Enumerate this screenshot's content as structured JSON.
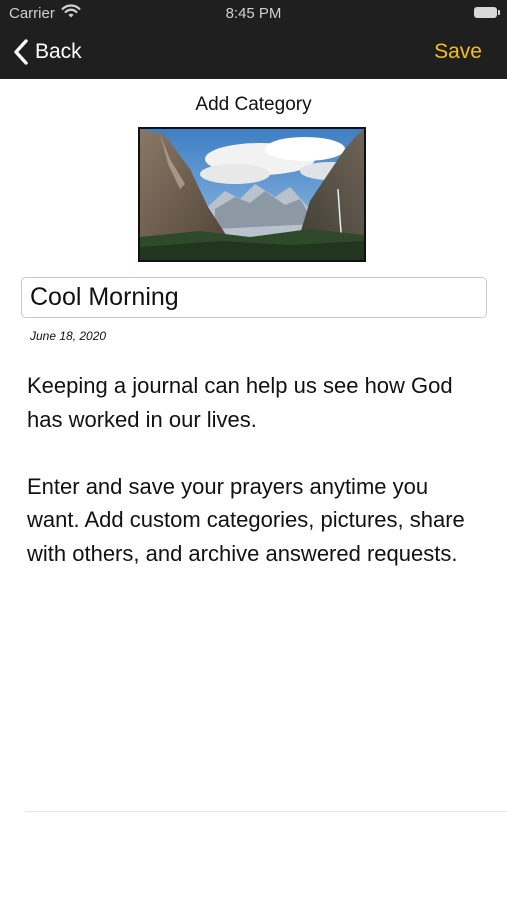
{
  "status_bar": {
    "carrier": "Carrier",
    "time": "8:45 PM",
    "wifi_icon": "wifi-icon",
    "battery_icon": "battery-icon"
  },
  "nav": {
    "back_icon": "chevron-left-icon",
    "back_label": "Back",
    "save_label": "Save",
    "save_color": "#f5bf1a",
    "bar_color": "#1f1f1f"
  },
  "page": {
    "title": "Add Category"
  },
  "entry": {
    "name_value": "Cool Morning",
    "date": "June 18, 2020",
    "paragraphs": [
      "Keeping a journal can help us see how God has worked in our lives.",
      "Enter and save your prayers anytime you want. Add custom categories, pictures, share with others, and archive answered requests."
    ]
  }
}
